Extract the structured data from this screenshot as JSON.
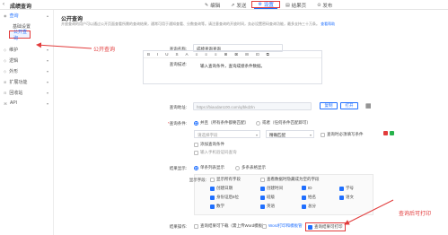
{
  "header": {
    "back_icon": "chevron-left-icon",
    "title": "成绩查询",
    "tabs": [
      {
        "icon": "edit-icon",
        "label": "编辑"
      },
      {
        "icon": "send-icon",
        "label": "发送"
      },
      {
        "icon": "gear-icon",
        "label": "设置"
      },
      {
        "icon": "doc-icon",
        "label": "结果页"
      },
      {
        "icon": "publish-icon",
        "label": "发布"
      }
    ],
    "active_tab": "设置"
  },
  "sidebar": {
    "top": {
      "label": "查询"
    },
    "subs": [
      {
        "label": "基础设置"
      },
      {
        "label": "公开查询"
      }
    ],
    "items": [
      {
        "label": "维护"
      },
      {
        "label": "逻辑"
      },
      {
        "label": "外形"
      },
      {
        "label": "扩展功能"
      },
      {
        "label": "回收站"
      },
      {
        "label": "API"
      }
    ]
  },
  "main": {
    "title": "公开查询",
    "desc": "开放查询的用户可以通过公开页面查看所需的查询结果，通常可用于通知查看、分数查询等。请注意查询的开放时间，务必设置密码查询功能，最多支持三十万条。",
    "desc_link": "查看帮助",
    "query_name_label": "查询名称:",
    "query_name_value": "成绩查询查询",
    "query_desc_label": "查询描述:",
    "editor_tools": [
      "B",
      "I",
      "U",
      "S",
      "A",
      "≡",
      "≡",
      "≡",
      "⊞",
      "⊠",
      "⊟",
      "⊡",
      "⧉"
    ],
    "editor_text": "输入查询条件，查询成绩条件数据。",
    "query_url_label": "查询地址:",
    "query_url_value": "https://biaodan100.com/q/bkdzln",
    "copy_btn": "复制",
    "open_btn": "打开",
    "qr_icon": "qr-code-icon",
    "cond_label": "查询条件:",
    "cond_opt1": "并且（所有条件都要匹配）",
    "cond_opt2": "或者（任何条件匹配即可）",
    "field_placeholder": "请选择字段",
    "match_value": "精确匹配",
    "required_label": "查询时必须填写条件",
    "add_cond": "添加查询条件",
    "add_phone": "输入手机验证码查询",
    "display_label": "结果显示:",
    "display_opt1": "单条列表显示",
    "display_opt2": "多条表格显示",
    "show_fields_label": "显示字段:",
    "show_all": "显示所有字段",
    "show_hidden": "查看数据时隐藏成为空的字段",
    "fields": [
      {
        "label": "创建日期",
        "on": true
      },
      {
        "label": "创建时间",
        "on": true
      },
      {
        "label": "ID",
        "on": true
      },
      {
        "label": "学号",
        "on": true
      },
      {
        "label": "身份证后6位",
        "on": true
      },
      {
        "label": "班级",
        "on": true
      },
      {
        "label": "姓名",
        "on": true
      },
      {
        "label": "语文",
        "on": true
      },
      {
        "label": "数学",
        "on": true
      },
      {
        "label": "英语",
        "on": true
      },
      {
        "label": "总分",
        "on": true
      }
    ],
    "result_ops_label": "结果操作:",
    "op_download": "查询结果可下载（需上传Word模板）",
    "op_word": "Word打印和模板管",
    "op_print": "查询结果可打印"
  },
  "annotations": {
    "public_query": "公开查询",
    "print_enable": "查询后可打印"
  },
  "colors": {
    "accent": "#1f6fff",
    "annotation": "#e23c3c"
  }
}
